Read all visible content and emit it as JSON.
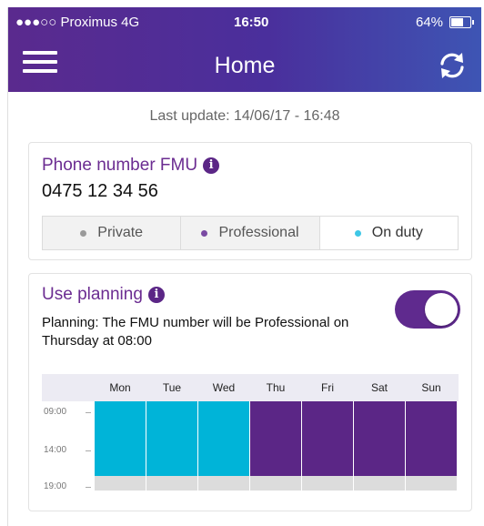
{
  "status_bar": {
    "carrier": "●●●○○ Proximus  4G",
    "time": "16:50",
    "battery": "64%"
  },
  "header": {
    "title": "Home",
    "menu_icon": "hamburger-icon",
    "refresh_icon": "refresh-icon"
  },
  "last_update": "Last update: 14/06/17 - 16:48",
  "phone_card": {
    "label": "Phone number FMU",
    "info_icon": "info-icon",
    "number": "0475 12 34 56",
    "modes": [
      {
        "label": "Private",
        "color": "#9a9a9a",
        "active": false
      },
      {
        "label": "Professional",
        "color": "#7a4aa3",
        "active": false
      },
      {
        "label": "On duty",
        "color": "#3ec7e6",
        "active": true
      }
    ]
  },
  "planning_card": {
    "label": "Use planning",
    "toggle_on": true,
    "description": "Planning: The FMU number will be Professional on Thursday at 08:00",
    "days": [
      "Mon",
      "Tue",
      "Wed",
      "Thu",
      "Fri",
      "Sat",
      "Sun"
    ],
    "hours": [
      "09:00",
      "14:00",
      "19:00"
    ],
    "day_colors": [
      "#00b4d8",
      "#00b4d8",
      "#00b4d8",
      "#5b2686",
      "#5b2686",
      "#5b2686",
      "#5b2686"
    ],
    "colors": {
      "on_duty": "#00b4d8",
      "professional": "#5b2686",
      "empty": "#dcdcdc"
    }
  }
}
